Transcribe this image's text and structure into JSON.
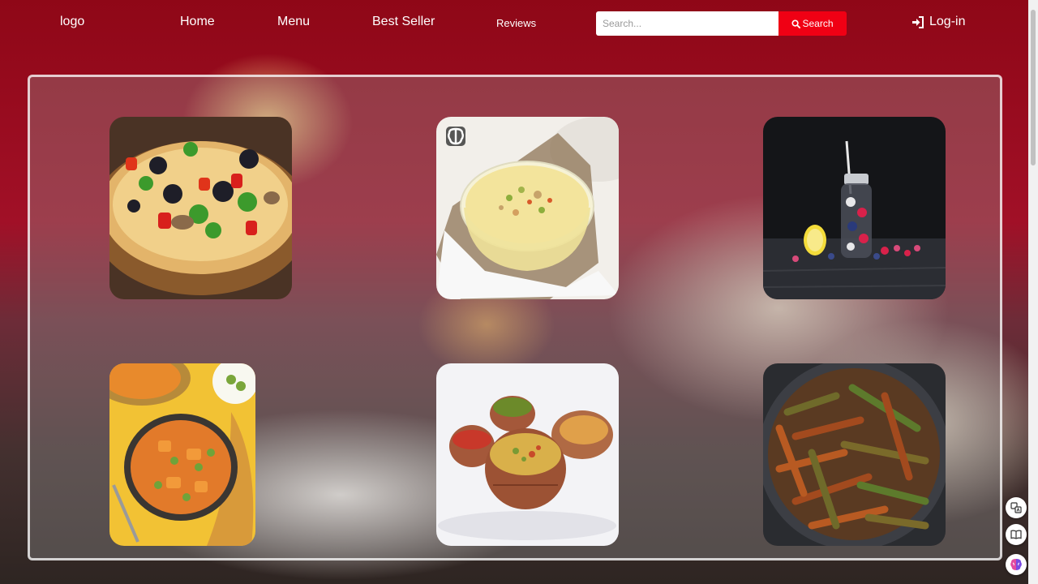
{
  "header": {
    "logo": "logo",
    "nav": [
      "Home",
      "Menu",
      "Best Seller",
      "Reviews"
    ],
    "search": {
      "placeholder": "Search...",
      "button_label": "Search"
    },
    "login_label": "Log-in"
  },
  "gallery": {
    "items": [
      {
        "name": "pizza"
      },
      {
        "name": "kheer-bowl"
      },
      {
        "name": "berry-drink"
      },
      {
        "name": "vegetable-curry"
      },
      {
        "name": "clay-pot-meal"
      },
      {
        "name": "bhindi-fry"
      }
    ]
  },
  "colors": {
    "accent": "#f00014",
    "header_bg": "#8f0717"
  },
  "icons": [
    "search-icon",
    "login-icon",
    "translate-icon",
    "reader-icon",
    "brain-icon"
  ]
}
